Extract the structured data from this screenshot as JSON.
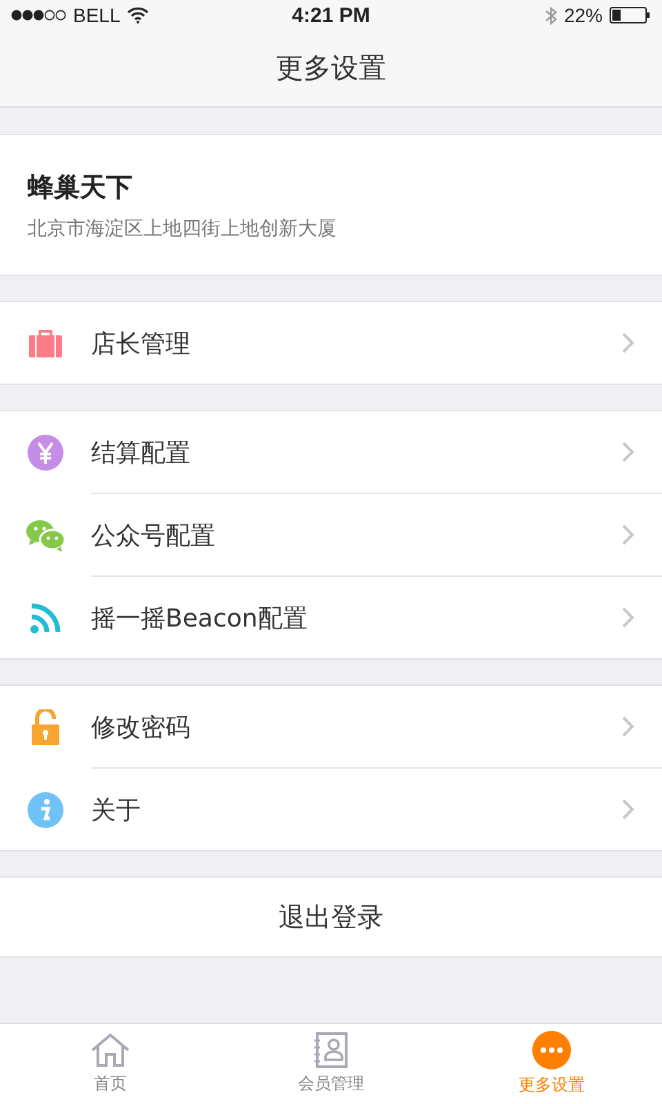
{
  "status_bar": {
    "carrier": "BELL",
    "time": "4:21 PM",
    "battery": "22%"
  },
  "nav": {
    "title": "更多设置"
  },
  "shop": {
    "name": "蜂巢天下",
    "address": "北京市海淀区上地四街上地创新大厦"
  },
  "groups": [
    {
      "items": [
        {
          "label": "店长管理"
        }
      ]
    },
    {
      "items": [
        {
          "label": "结算配置"
        },
        {
          "label": "公众号配置"
        },
        {
          "label": "摇一摇Beacon配置"
        }
      ]
    },
    {
      "items": [
        {
          "label": "修改密码"
        },
        {
          "label": "关于"
        }
      ]
    }
  ],
  "logout": "退出登录",
  "tabs": [
    {
      "label": "首页",
      "selected": false
    },
    {
      "label": "会员管理",
      "selected": false
    },
    {
      "label": "更多设置",
      "selected": true
    }
  ]
}
